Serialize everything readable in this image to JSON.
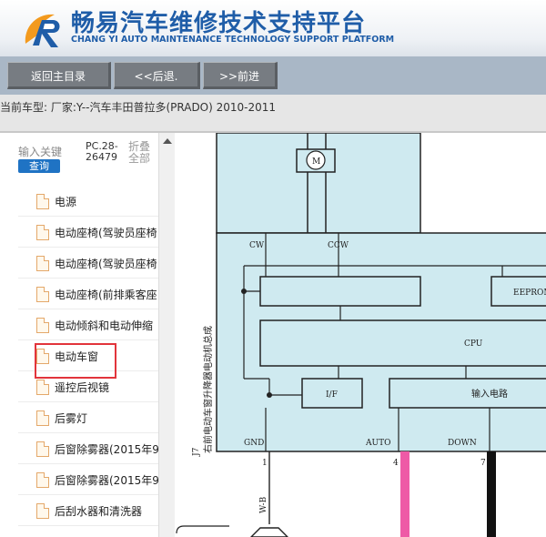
{
  "header": {
    "title_cn": "畅易汽车维修技术支持平台",
    "title_en": "CHANG YI AUTO MAINTENANCE TECHNOLOGY SUPPORT PLATFORM",
    "brand_color": "#1f5da8"
  },
  "nav": {
    "back_main": "返回主目录",
    "prev": "<<后退.",
    "next": ">>前进"
  },
  "info": {
    "current_model": "当前车型:  厂家:Y--汽车丰田普拉多(PRADO) 2010-2011"
  },
  "sidebar": {
    "keyword_placeholder": "输入关键",
    "query_label": "查询",
    "pc_code": "PC.28-26479",
    "fold_all": "折叠全部",
    "items": [
      {
        "label": "电源"
      },
      {
        "label": "电动座椅(驾驶员座椅"
      },
      {
        "label": "电动座椅(驾驶员座椅"
      },
      {
        "label": "电动座椅(前排乘客座"
      },
      {
        "label": "电动倾斜和电动伸缩"
      },
      {
        "label": "电动车窗",
        "selected": true
      },
      {
        "label": "遥控后视镜"
      },
      {
        "label": "后雾灯"
      },
      {
        "label": "后窗除雾器(2015年9"
      },
      {
        "label": "后窗除雾器(2015年9"
      },
      {
        "label": "后刮水器和清洗器"
      }
    ]
  },
  "diagram": {
    "motor_label": "M",
    "pin_labels": [
      "CW",
      "CCW"
    ],
    "blocks": [
      "EEPROM",
      "CPU",
      "I/F",
      "输入电路"
    ],
    "bottom_labels": [
      "GND",
      "AUTO",
      "DOWN"
    ],
    "pin_numbers": [
      "1",
      "4",
      "7"
    ],
    "wire_label": "W-B",
    "connector_label": "J7",
    "component_name": "右前电动车窗升降器电动机总成",
    "fill_color": "#cfeaf0",
    "wire_pink": "#ee5aa6"
  }
}
